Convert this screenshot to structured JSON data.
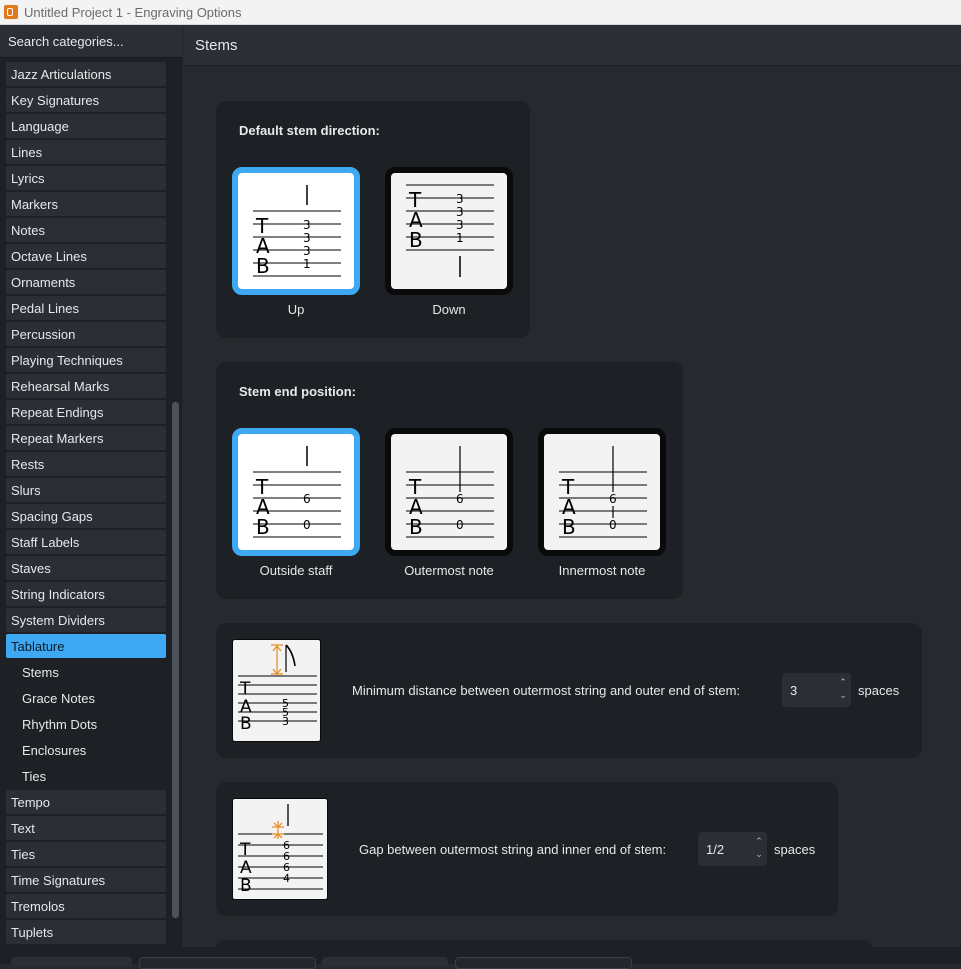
{
  "window": {
    "title": "Untitled Project 1 - Engraving Options"
  },
  "sidebar": {
    "search_placeholder": "Search categories...",
    "items": [
      {
        "label": "Jazz Articulations"
      },
      {
        "label": "Key Signatures"
      },
      {
        "label": "Language"
      },
      {
        "label": "Lines"
      },
      {
        "label": "Lyrics"
      },
      {
        "label": "Markers"
      },
      {
        "label": "Notes"
      },
      {
        "label": "Octave Lines"
      },
      {
        "label": "Ornaments"
      },
      {
        "label": "Pedal Lines"
      },
      {
        "label": "Percussion"
      },
      {
        "label": "Playing Techniques"
      },
      {
        "label": "Rehearsal Marks"
      },
      {
        "label": "Repeat Endings"
      },
      {
        "label": "Repeat Markers"
      },
      {
        "label": "Rests"
      },
      {
        "label": "Slurs"
      },
      {
        "label": "Spacing Gaps"
      },
      {
        "label": "Staff Labels"
      },
      {
        "label": "Staves"
      },
      {
        "label": "String Indicators"
      },
      {
        "label": "System Dividers"
      },
      {
        "label": "Tablature"
      }
    ],
    "sub_items": [
      {
        "label": "Stems"
      },
      {
        "label": "Grace Notes"
      },
      {
        "label": "Rhythm Dots"
      },
      {
        "label": "Enclosures"
      },
      {
        "label": "Ties"
      }
    ],
    "items_after": [
      {
        "label": "Tempo"
      },
      {
        "label": "Text"
      },
      {
        "label": "Ties"
      },
      {
        "label": "Time Signatures"
      },
      {
        "label": "Tremolos"
      },
      {
        "label": "Tuplets"
      }
    ],
    "selected": "Tablature"
  },
  "header": {
    "title": "Stems"
  },
  "stem_direction": {
    "title": "Default stem direction:",
    "options": [
      {
        "label": "Up",
        "selected": true
      },
      {
        "label": "Down",
        "selected": false
      }
    ]
  },
  "stem_end": {
    "title": "Stem end position:",
    "options": [
      {
        "label": "Outside staff",
        "selected": true
      },
      {
        "label": "Outermost note",
        "selected": false
      },
      {
        "label": "Innermost note",
        "selected": false
      }
    ]
  },
  "min_distance": {
    "label": "Minimum distance between outermost string and outer end of stem:",
    "value": "3",
    "unit": "spaces"
  },
  "gap": {
    "label": "Gap between outermost string and inner end of stem:",
    "value": "1/2",
    "unit": "spaces"
  },
  "tab_letters": {
    "t": "T",
    "a": "A",
    "b": "B"
  },
  "fret_numbers": {
    "up_down": [
      "3",
      "3",
      "3",
      "1"
    ],
    "stem_end": [
      "6",
      "0"
    ],
    "min_dist": [
      "5",
      "5",
      "3"
    ],
    "gap": [
      "6",
      "6",
      "6",
      "4"
    ]
  },
  "colors": {
    "accent": "#3ea9f2",
    "highlight": "#e8902a"
  }
}
